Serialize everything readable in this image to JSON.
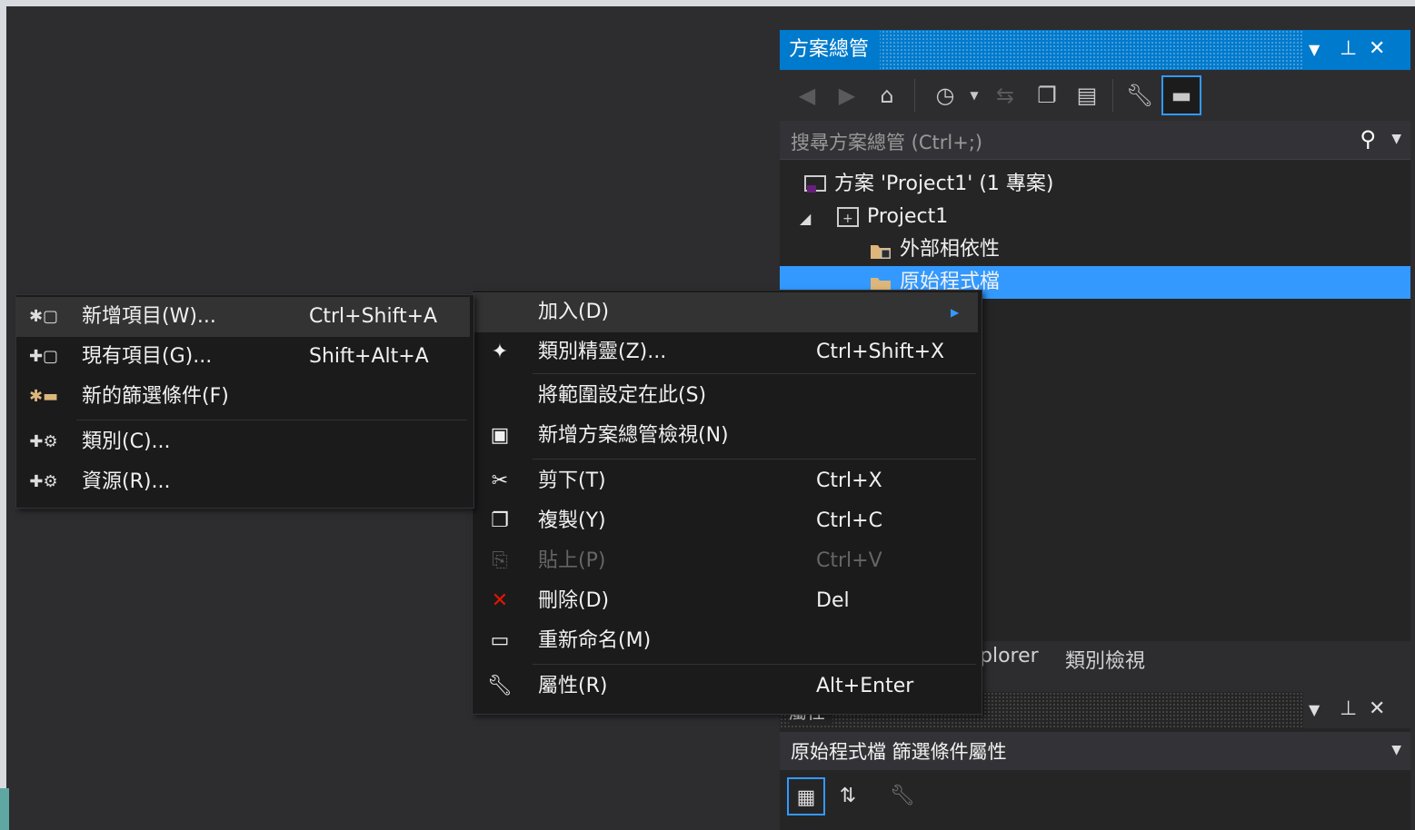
{
  "solution_explorer": {
    "title": "方案總管",
    "search_placeholder": "搜尋方案總管 (Ctrl+;)",
    "tree": {
      "solution": "方案 'Project1' (1 專案)",
      "project": "Project1",
      "external_deps": "外部相依性",
      "source_files": "原始程式檔"
    }
  },
  "bottom_tabs": {
    "tab1": "plorer",
    "tab2": "類別檢視"
  },
  "properties": {
    "title": "屬性",
    "object": "原始程式檔  篩選條件屬性"
  },
  "context_menu": {
    "items": [
      {
        "label": "加入(D)",
        "shortcut": "",
        "icon": "none"
      },
      {
        "label": "類別精靈(Z)...",
        "shortcut": "Ctrl+Shift+X",
        "icon": "class-wizard-icon"
      },
      {
        "label": "將範圍設定在此(S)",
        "shortcut": "",
        "icon": "none"
      },
      {
        "label": "新增方案總管檢視(N)",
        "shortcut": "",
        "icon": "new-view-icon"
      },
      {
        "label": "剪下(T)",
        "shortcut": "Ctrl+X",
        "icon": "cut-icon"
      },
      {
        "label": "複製(Y)",
        "shortcut": "Ctrl+C",
        "icon": "copy-icon"
      },
      {
        "label": "貼上(P)",
        "shortcut": "Ctrl+V",
        "icon": "paste-icon"
      },
      {
        "label": "刪除(D)",
        "shortcut": "Del",
        "icon": "delete-icon"
      },
      {
        "label": "重新命名(M)",
        "shortcut": "",
        "icon": "rename-icon"
      },
      {
        "label": "屬性(R)",
        "shortcut": "Alt+Enter",
        "icon": "wrench-icon"
      }
    ]
  },
  "add_submenu": {
    "items": [
      {
        "label": "新增項目(W)...",
        "shortcut": "Ctrl+Shift+A"
      },
      {
        "label": "現有項目(G)...",
        "shortcut": "Shift+Alt+A"
      },
      {
        "label": "新的篩選條件(F)",
        "shortcut": ""
      },
      {
        "label": "類別(C)...",
        "shortcut": ""
      },
      {
        "label": "資源(R)...",
        "shortcut": ""
      }
    ]
  },
  "colors": {
    "accent": "#007acc",
    "selection": "#3399ff",
    "menu_bg": "#1b1b1c",
    "ide_bg": "#2d2d30"
  }
}
